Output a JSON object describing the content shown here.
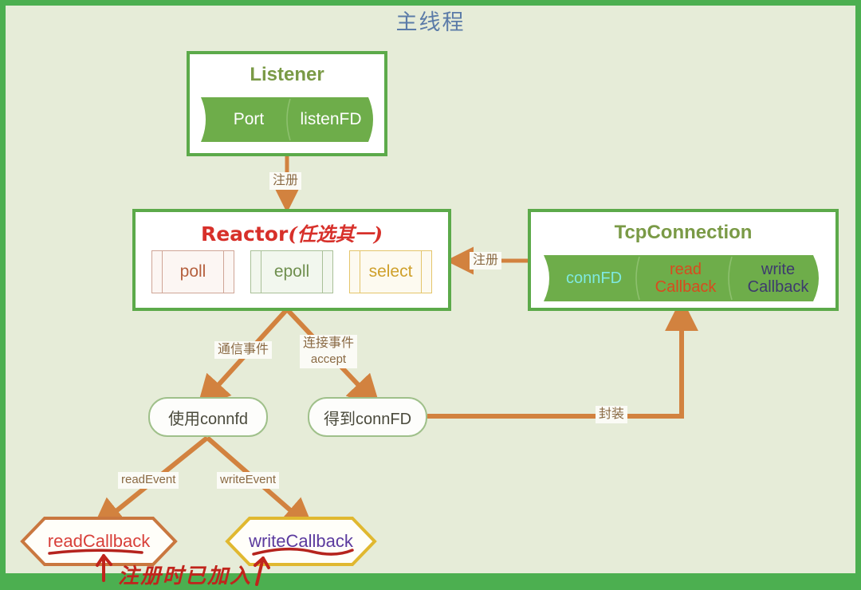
{
  "page": {
    "title": "主线程",
    "title_color": "#5b7ba8",
    "frame_border_color": "#4caf50",
    "background_color": "#e6ecd8"
  },
  "listener": {
    "title": "Listener",
    "fields": [
      {
        "label": "Port",
        "color": "#ffffff"
      },
      {
        "label": "listenFD",
        "color": "#ffffff"
      }
    ],
    "ribbon_color": "#6ead4a"
  },
  "reactor": {
    "title_main": "Reactor",
    "title_note": "(任选其一)",
    "title_color": "#d7302a",
    "options": [
      {
        "label": "poll",
        "text_color": "#b5603e",
        "border_color": "#cfa596",
        "fill_color": "#fcf6f3"
      },
      {
        "label": "epoll",
        "text_color": "#6f8f4e",
        "border_color": "#a9c098",
        "fill_color": "#f2f7ee"
      },
      {
        "label": "select",
        "text_color": "#cfa02b",
        "border_color": "#e4c56a",
        "fill_color": "#fdfaf0"
      }
    ]
  },
  "tcp_connection": {
    "title": "TcpConnection",
    "fields": [
      {
        "label": "connFD",
        "color": "#7fe9e0"
      },
      {
        "label": "read\nCallback",
        "color": "#d94a1e"
      },
      {
        "label": "write\nCallback",
        "color": "#3d3a6e"
      }
    ],
    "ribbon_color": "#6ead4a"
  },
  "nodes": {
    "use_connfd": "使用connfd",
    "get_connfd": "得到connFD"
  },
  "callbacks": [
    {
      "label": "readCallback",
      "text_color": "#d8403a",
      "border_color": "#c9773f"
    },
    {
      "label": "writeCallback",
      "text_color": "#5b3a9e",
      "border_color": "#e0b830"
    }
  ],
  "edges": [
    {
      "name": "listener-to-reactor",
      "label": "注册"
    },
    {
      "name": "tcpconnection-to-reactor",
      "label": "注册"
    },
    {
      "name": "reactor-to-use-connfd",
      "label": "通信事件"
    },
    {
      "name": "reactor-to-get-connfd",
      "label": "连接事件\naccept"
    },
    {
      "name": "get-connfd-to-tcpconnection",
      "label": "封装"
    },
    {
      "name": "use-connfd-to-readcallback",
      "label": "readEvent"
    },
    {
      "name": "use-connfd-to-writecallback",
      "label": "writeEvent"
    }
  ],
  "annotation": {
    "handwritten_note": "注册时已加入",
    "color": "#c0241c"
  },
  "arrow_color": "#d2823f"
}
